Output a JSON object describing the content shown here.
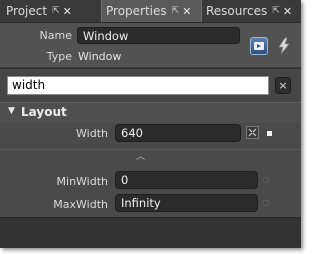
{
  "tabs": [
    {
      "label": "Project"
    },
    {
      "label": "Properties"
    },
    {
      "label": "Resources"
    }
  ],
  "header": {
    "name_label": "Name",
    "name_value": "Window",
    "type_label": "Type",
    "type_value": "Window"
  },
  "search": {
    "value": "width",
    "clear_glyph": "×"
  },
  "category": {
    "title": "Layout",
    "properties": [
      {
        "label": "Width",
        "value": "640"
      },
      {
        "label": "MinWidth",
        "value": "0"
      },
      {
        "label": "MaxWidth",
        "value": "Infinity"
      }
    ]
  },
  "icons": {
    "tab_pin": "pin-icon",
    "tab_close": "close-icon",
    "events": "events-lightning-icon",
    "properties": "properties-icon",
    "expand": "chevron-up-icon",
    "collapse": "triangle-down-icon",
    "advanced": "advanced-options-icon"
  }
}
